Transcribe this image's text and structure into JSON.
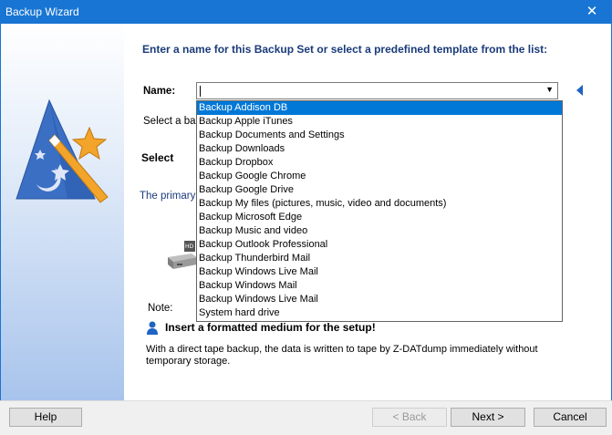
{
  "window": {
    "title": "Backup Wizard",
    "close_glyph": "✕"
  },
  "content": {
    "heading": "Enter a name for this Backup Set or select a predefined template from the list:",
    "name_label": "Name:",
    "name_value": "",
    "select_backup_text": "Select a bac",
    "select_label": "Select",
    "primary_text": "The primary b",
    "note_label": "Note:",
    "warning_text": "Insert a formatted medium for the setup!",
    "tape_line1": "With a direct tape backup, the data is written to tape by Z-DATdump immediately without",
    "tape_line2": "temporary storage."
  },
  "dropdown": {
    "items": [
      "Backup Addison DB",
      "Backup Apple iTunes",
      "Backup Documents and Settings",
      "Backup Downloads",
      "Backup Dropbox",
      "Backup Google Chrome",
      "Backup Google Drive",
      "Backup My files (pictures, music, video and documents)",
      "Backup Microsoft Edge",
      "Backup Music and video",
      "Backup Outlook Professional",
      "Backup Thunderbird Mail",
      "Backup Windows Live Mail",
      "Backup Windows Mail",
      "Backup Windows Live Mail",
      "System hard drive"
    ],
    "selected_index": 0
  },
  "buttons": {
    "help": "Help",
    "back": "< Back",
    "next": "Next >",
    "cancel": "Cancel"
  },
  "icons": {
    "wizard": "wizard-hat-icon",
    "drive": "hard-drive-icon",
    "warning": "user-info-icon",
    "arrow": "left-arrow-icon"
  },
  "colors": {
    "titlebar": "#1875d3",
    "heading": "#1a3b7a",
    "primary_text": "#1a3b7a",
    "selection": "#0078d7"
  }
}
